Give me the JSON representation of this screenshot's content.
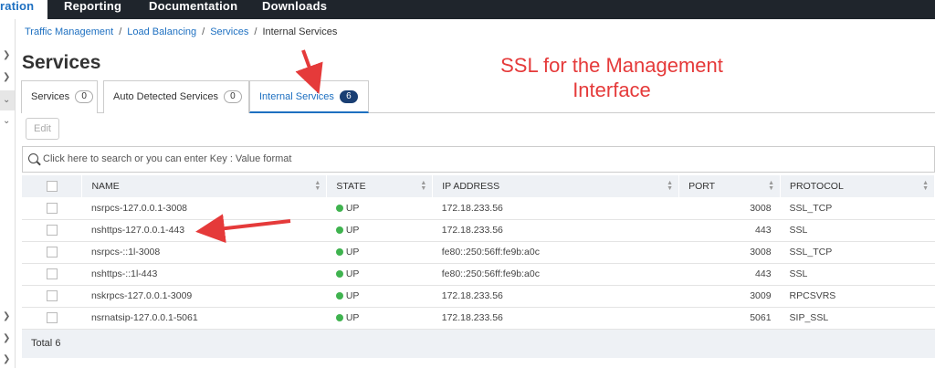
{
  "topnav": {
    "tabs": [
      {
        "label": "ration",
        "active": true
      },
      {
        "label": "Reporting",
        "active": false
      },
      {
        "label": "Documentation",
        "active": false
      },
      {
        "label": "Downloads",
        "active": false
      }
    ]
  },
  "breadcrumb": {
    "items": [
      "Traffic Management",
      "Load Balancing",
      "Services"
    ],
    "current": "Internal Services",
    "separator": "/"
  },
  "page": {
    "title": "Services"
  },
  "tabs": [
    {
      "label": "Services",
      "count": "0"
    },
    {
      "label": "Auto Detected Services",
      "count": "0"
    },
    {
      "label": "Internal Services",
      "count": "6"
    }
  ],
  "toolbar": {
    "edit_label": "Edit"
  },
  "search": {
    "placeholder": "Click here to search or you can enter Key : Value format"
  },
  "table": {
    "columns": [
      "NAME",
      "STATE",
      "IP ADDRESS",
      "PORT",
      "PROTOCOL"
    ],
    "rows": [
      {
        "name": "nsrpcs-127.0.0.1-3008",
        "state": "UP",
        "ip": "172.18.233.56",
        "port": "3008",
        "protocol": "SSL_TCP"
      },
      {
        "name": "nshttps-127.0.0.1-443",
        "state": "UP",
        "ip": "172.18.233.56",
        "port": "443",
        "protocol": "SSL"
      },
      {
        "name": "nsrpcs-::1l-3008",
        "state": "UP",
        "ip": "fe80::250:56ff:fe9b:a0c",
        "port": "3008",
        "protocol": "SSL_TCP"
      },
      {
        "name": "nshttps-::1l-443",
        "state": "UP",
        "ip": "fe80::250:56ff:fe9b:a0c",
        "port": "443",
        "protocol": "SSL"
      },
      {
        "name": "nskrpcs-127.0.0.1-3009",
        "state": "UP",
        "ip": "172.18.233.56",
        "port": "3009",
        "protocol": "RPCSVRS"
      },
      {
        "name": "nsrnatsip-127.0.0.1-5061",
        "state": "UP",
        "ip": "172.18.233.56",
        "port": "5061",
        "protocol": "SIP_SSL"
      }
    ],
    "total_label": "Total",
    "total_value": "6"
  },
  "annotation": {
    "line1": "SSL for the Management",
    "line2": "Interface"
  },
  "colors": {
    "accent": "#1e70c1",
    "nav_bg": "#1f252c",
    "status_up": "#3fb34f",
    "annotation": "#e53a3a"
  }
}
